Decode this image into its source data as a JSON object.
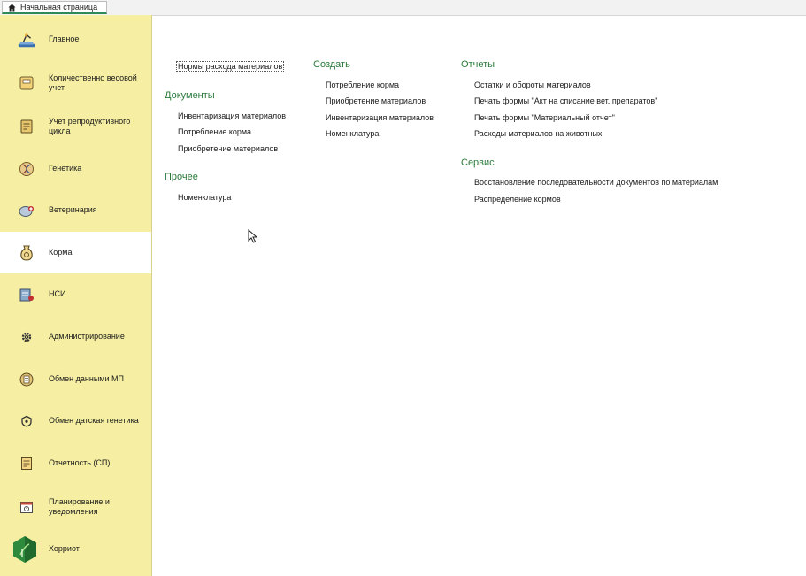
{
  "tab": {
    "label": "Начальная страница"
  },
  "sidebar": {
    "items": [
      {
        "label": "Главное",
        "icon": "desk-lamp-icon"
      },
      {
        "label": "Количественно весовой учет",
        "icon": "scale-icon"
      },
      {
        "label": "Учет репродуктивного цикла",
        "icon": "notepad-icon"
      },
      {
        "label": "Генетика",
        "icon": "dna-icon"
      },
      {
        "label": "Ветеринария",
        "icon": "vet-icon"
      },
      {
        "label": "Корма",
        "icon": "feed-sack-icon"
      },
      {
        "label": "НСИ",
        "icon": "reference-icon"
      },
      {
        "label": "Администрирование",
        "icon": "gear-icon"
      },
      {
        "label": "Обмен данными МП",
        "icon": "exchange-icon"
      },
      {
        "label": "Обмен датская генетика",
        "icon": "shield-icon"
      },
      {
        "label": "Отчетность (СП)",
        "icon": "report-icon"
      },
      {
        "label": "Планирование и уведомления",
        "icon": "calendar-icon"
      },
      {
        "label": "Хорриот",
        "icon": "horriot-logo-icon"
      }
    ],
    "active_index": 5
  },
  "content": {
    "top_link": "Нормы расхода материалов",
    "documents": {
      "title": "Документы",
      "items": [
        "Инвентаризация материалов",
        "Потребление корма",
        "Приобретение материалов"
      ]
    },
    "other": {
      "title": "Прочее",
      "items": [
        "Номенклатура"
      ]
    },
    "create": {
      "title": "Создать",
      "items": [
        "Потребление корма",
        "Приобретение материалов",
        "Инвентаризация материалов",
        "Номенклатура"
      ]
    },
    "reports": {
      "title": "Отчеты",
      "items": [
        "Остатки и обороты материалов",
        "Печать формы \"Акт на списание вет. препаратов\"",
        "Печать формы \"Материальный отчет\"",
        "Расходы материалов на животных"
      ]
    },
    "service": {
      "title": "Сервис",
      "items": [
        "Восстановление последовательности документов по материалам",
        "Распределение кормов"
      ]
    }
  },
  "colors": {
    "sidebar_bg": "#f6efa3",
    "section_title": "#2a7a3a",
    "tab_accent": "#2e8b57"
  }
}
